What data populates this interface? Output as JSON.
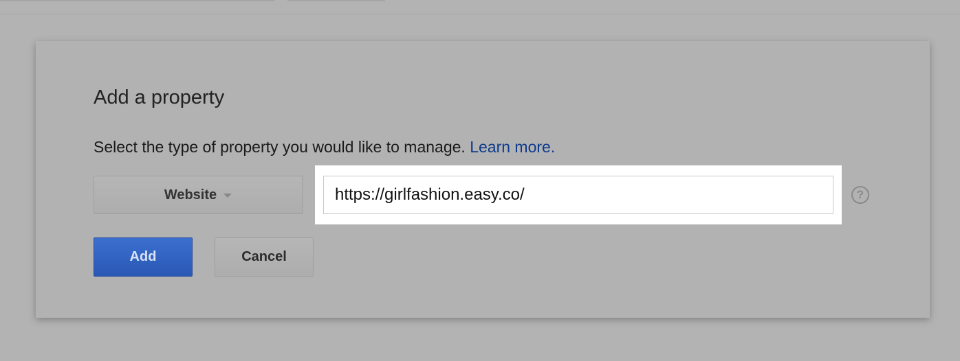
{
  "dialog": {
    "title": "Add a property",
    "description": "Select the type of property you would like to manage.",
    "learn_more_link": "Learn more.",
    "type_select": {
      "selected": "Website",
      "icon": "caret-down-icon"
    },
    "url_input": {
      "value": "https://girlfashion.easy.co/"
    },
    "help_icon": {
      "glyph": "?",
      "icon": "question-circle-icon"
    },
    "add_button": "Add",
    "cancel_button": "Cancel"
  },
  "colors": {
    "overlay_background": "#b3b3b3",
    "primary_button": "#2a58b5",
    "link": "#0d3a8c",
    "highlight": "#ffffff"
  }
}
